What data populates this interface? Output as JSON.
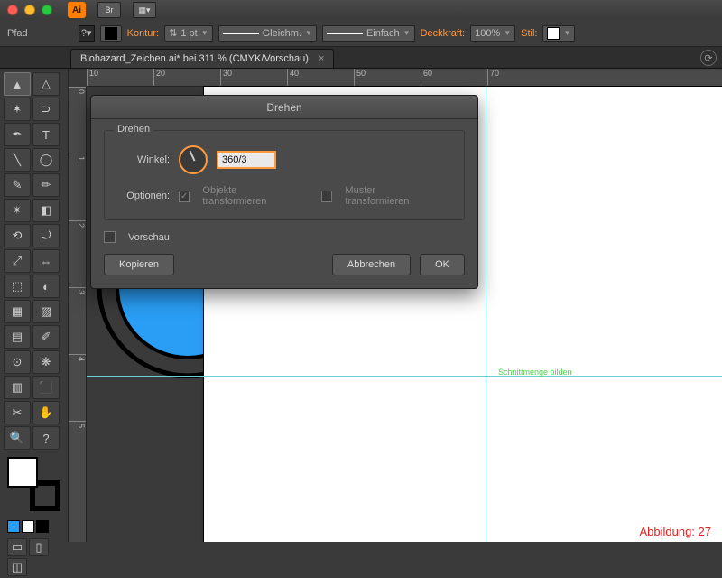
{
  "titlebar": {
    "app_abbr": "Ai",
    "br_label": "Br"
  },
  "optbar": {
    "path_label": "Pfad",
    "stroke_label": "Kontur:",
    "stroke_weight": "1 pt",
    "cap_label": "Gleichm.",
    "corner_label": "Einfach",
    "opacity_label": "Deckkraft:",
    "opacity_value": "100%",
    "style_label": "Stil:"
  },
  "doc_tab": {
    "title": "Biohazard_Zeichen.ai* bei 311 % (CMYK/Vorschau)"
  },
  "ruler_h": [
    "10",
    "20",
    "30",
    "40",
    "50",
    "60",
    "70"
  ],
  "ruler_v": [
    "0",
    "1",
    "2",
    "3",
    "4",
    "5"
  ],
  "smart_guide": "Schnittmenge bilden",
  "footer": "Abbildung: 27",
  "dialog": {
    "title": "Drehen",
    "section": "Drehen",
    "angle_label": "Winkel:",
    "angle_value": "360/3",
    "options_label": "Optionen:",
    "opt_transform_obj": "Objekte transformieren",
    "opt_transform_pat": "Muster transformieren",
    "preview_label": "Vorschau",
    "btn_copy": "Kopieren",
    "btn_cancel": "Abbrechen",
    "btn_ok": "OK"
  },
  "swatches": [
    "#2a9df4",
    "#ffffff",
    "#000000",
    "#e02020",
    "#f5d300",
    "#2ab34a"
  ]
}
